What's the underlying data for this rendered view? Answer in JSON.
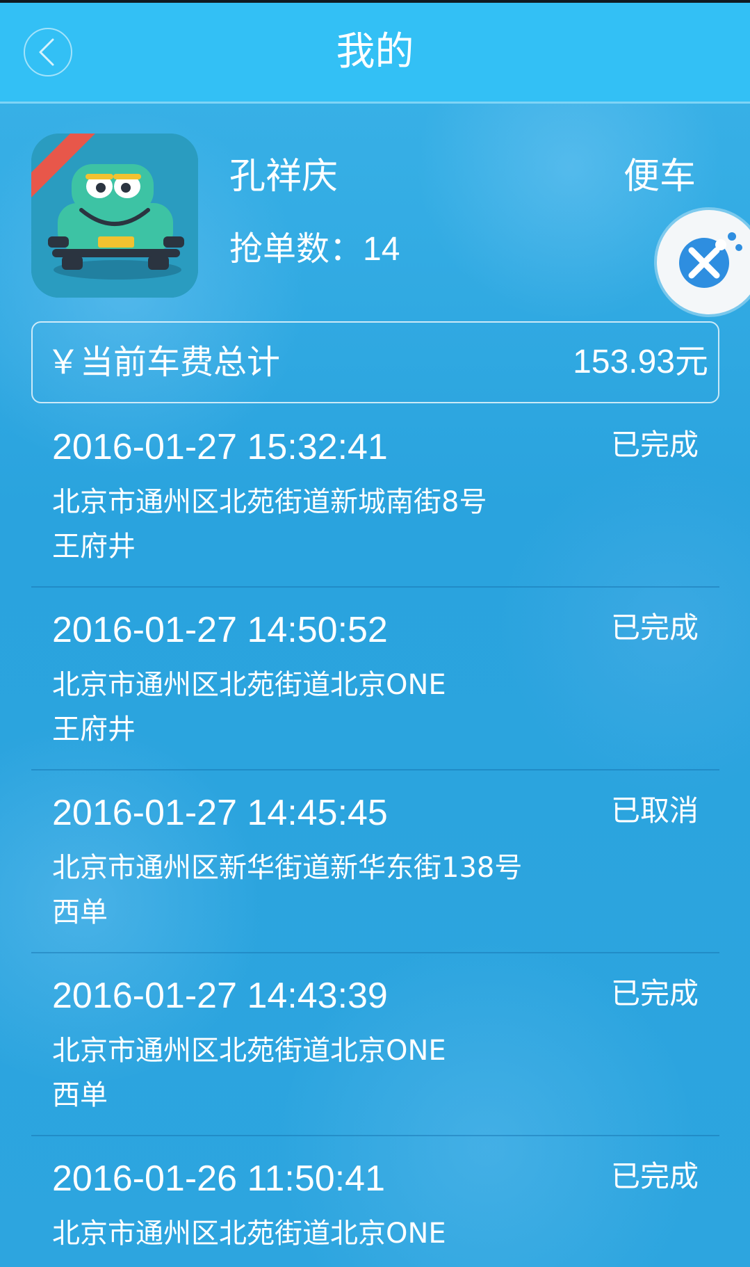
{
  "header": {
    "title": "我的",
    "back_icon": "chevron-left-icon"
  },
  "profile": {
    "name": "孔祥庆",
    "car_type": "便车",
    "order_count_label": "抢单数：",
    "order_count": "14",
    "avatar_icon": "car-mascot-icon"
  },
  "floating_button": {
    "icon": "tools-icon",
    "color": "#2e8ee0"
  },
  "fee": {
    "label": "￥当前车费总计",
    "value": "153.93元"
  },
  "orders": [
    {
      "time": "2016-01-27 15:32:41",
      "status": "已完成",
      "from": "北京市通州区北苑街道新城南街8号",
      "to": "王府井"
    },
    {
      "time": "2016-01-27 14:50:52",
      "status": "已完成",
      "from": "北京市通州区北苑街道北京ONE",
      "to": "王府井"
    },
    {
      "time": "2016-01-27 14:45:45",
      "status": "已取消",
      "from": "北京市通州区新华街道新华东街138号",
      "to": "西单"
    },
    {
      "time": "2016-01-27 14:43:39",
      "status": "已完成",
      "from": "北京市通州区北苑街道北京ONE",
      "to": "西单"
    },
    {
      "time": "2016-01-26 11:50:41",
      "status": "已完成",
      "from": "北京市通州区北苑街道北京ONE",
      "to": ""
    }
  ],
  "colors": {
    "header_bg": "#33c0f5",
    "page_bg": "#2ba6e0",
    "text": "#ffffff"
  }
}
